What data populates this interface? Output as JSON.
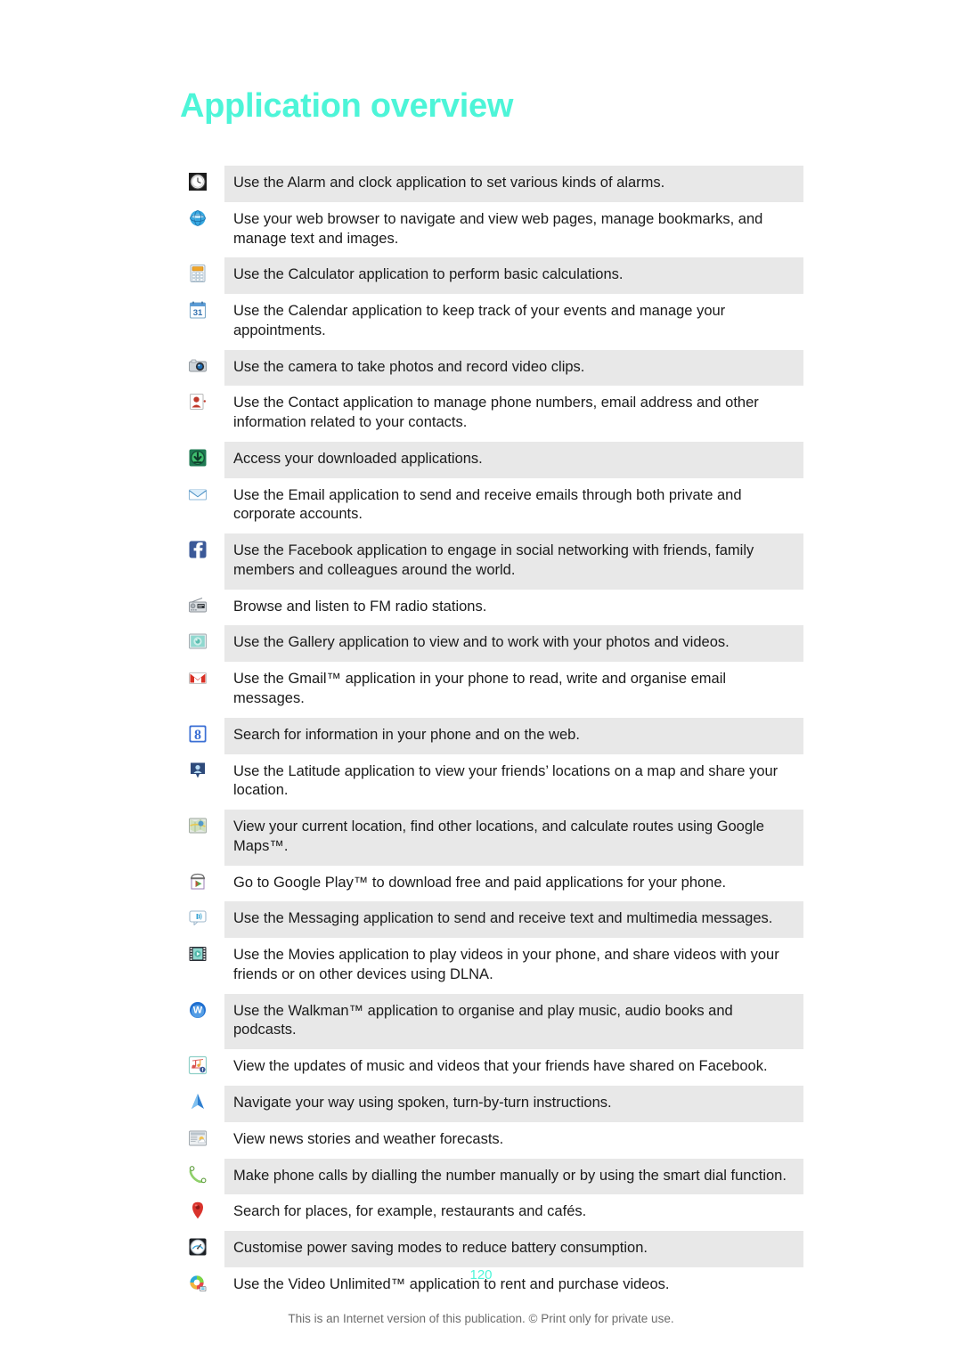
{
  "document": {
    "title": "Application overview",
    "title_color": "#4df5d8",
    "page_number": "120",
    "footer_note": "This is an Internet version of this publication. © Print only for private use."
  },
  "rows": [
    {
      "icon": "alarm-clock-icon",
      "shaded": true,
      "text": "Use the Alarm and clock application to set various kinds of alarms."
    },
    {
      "icon": "web-browser-globe-icon",
      "shaded": false,
      "text": "Use your web browser to navigate and view web pages, manage bookmarks, and manage text and images."
    },
    {
      "icon": "calculator-icon",
      "shaded": true,
      "text": "Use the Calculator application to perform basic calculations."
    },
    {
      "icon": "calendar-icon",
      "shaded": false,
      "text": "Use the Calendar application to keep track of your events and manage your appointments."
    },
    {
      "icon": "camera-icon",
      "shaded": true,
      "text": "Use the camera to take photos and record video clips."
    },
    {
      "icon": "contacts-icon",
      "shaded": false,
      "text": "Use the Contact application to manage phone numbers, email address and other information related to your contacts."
    },
    {
      "icon": "downloads-icon",
      "shaded": true,
      "text": "Access your downloaded applications."
    },
    {
      "icon": "email-envelope-icon",
      "shaded": false,
      "text": "Use the Email application to send and receive emails through both private and corporate accounts."
    },
    {
      "icon": "facebook-icon",
      "shaded": true,
      "text": "Use the Facebook application to engage in social networking with friends, family members and colleagues around the world."
    },
    {
      "icon": "fm-radio-icon",
      "shaded": false,
      "text": "Browse and listen to FM radio stations."
    },
    {
      "icon": "gallery-icon",
      "shaded": true,
      "text": "Use the Gallery application to view and to work with your photos and videos."
    },
    {
      "icon": "gmail-icon",
      "shaded": false,
      "text": "Use the Gmail™ application in your phone to read, write and organise email messages."
    },
    {
      "icon": "google-search-icon",
      "shaded": true,
      "text": "Search for information in your phone and on the web."
    },
    {
      "icon": "latitude-icon",
      "shaded": false,
      "text": "Use the Latitude application to view your friends’ locations on a map and share your location."
    },
    {
      "icon": "google-maps-icon",
      "shaded": true,
      "text": "View your current location, find other locations, and calculate routes using Google Maps™."
    },
    {
      "icon": "google-play-icon",
      "shaded": false,
      "text": "Go to Google Play™ to download free and paid applications for your phone."
    },
    {
      "icon": "messaging-icon",
      "shaded": true,
      "text": "Use the Messaging application to send and receive text and multimedia messages."
    },
    {
      "icon": "movies-icon",
      "shaded": false,
      "text": "Use the Movies application to play videos in your phone, and share videos with your friends or on other devices using DLNA."
    },
    {
      "icon": "walkman-icon",
      "shaded": true,
      "text": "Use the Walkman™ application to organise and play music, audio books and podcasts."
    },
    {
      "icon": "music-facebook-icon",
      "shaded": false,
      "text": "View the updates of music and videos that your friends have shared on Facebook."
    },
    {
      "icon": "navigation-arrow-icon",
      "shaded": true,
      "text": "Navigate your way using spoken, turn-by-turn instructions."
    },
    {
      "icon": "news-weather-icon",
      "shaded": false,
      "text": "View news stories and weather forecasts."
    },
    {
      "icon": "phone-handset-icon",
      "shaded": true,
      "text": "Make phone calls by dialling the number manually or by using the smart dial function."
    },
    {
      "icon": "places-pin-icon",
      "shaded": false,
      "text": "Search for places, for example, restaurants and cafés."
    },
    {
      "icon": "power-saver-icon",
      "shaded": true,
      "text": "Customise power saving modes to reduce battery consumption."
    },
    {
      "icon": "video-unlimited-icon",
      "shaded": false,
      "text": "Use the Video Unlimited™ application to rent and purchase videos."
    }
  ]
}
